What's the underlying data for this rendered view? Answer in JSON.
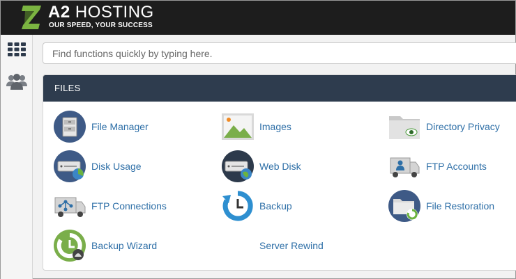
{
  "header": {
    "brand_prefix": "A2",
    "brand_name": "HOSTING",
    "tagline": "OUR SPEED, YOUR SUCCESS",
    "logo_icon": "a2-logo-icon",
    "colors": {
      "bar": "#1d1d1d",
      "logo_green": "#7bb441"
    }
  },
  "sidebar": {
    "items": [
      {
        "icon": "apps-grid-icon"
      },
      {
        "icon": "users-icon"
      }
    ]
  },
  "search": {
    "placeholder": "Find functions quickly by typing here.",
    "value": ""
  },
  "files_section": {
    "title": "FILES",
    "header_color": "#2e3c4e",
    "link_color": "#2e6fa7",
    "items": [
      {
        "label": "File Manager",
        "icon": "file-manager-icon"
      },
      {
        "label": "Images",
        "icon": "images-icon"
      },
      {
        "label": "Directory Privacy",
        "icon": "directory-privacy-icon"
      },
      {
        "label": "Disk Usage",
        "icon": "disk-usage-icon"
      },
      {
        "label": "Web Disk",
        "icon": "web-disk-icon"
      },
      {
        "label": "FTP Accounts",
        "icon": "ftp-accounts-icon"
      },
      {
        "label": "FTP Connections",
        "icon": "ftp-connections-icon"
      },
      {
        "label": "Backup",
        "icon": "backup-icon"
      },
      {
        "label": "File Restoration",
        "icon": "file-restoration-icon"
      },
      {
        "label": "Backup Wizard",
        "icon": "backup-wizard-icon"
      },
      {
        "label": "Server Rewind",
        "icon": ""
      }
    ]
  }
}
